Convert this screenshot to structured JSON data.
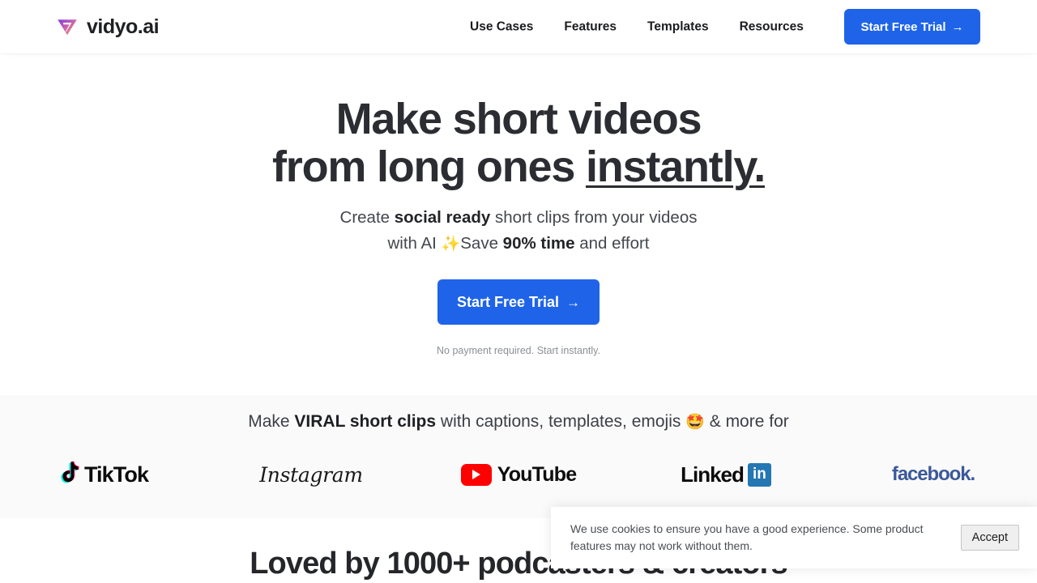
{
  "header": {
    "brand": {
      "name": "vidyo.ai",
      "logo_icon": "vidyo-triangle-play-logo"
    },
    "nav": [
      {
        "label": "Use Cases"
      },
      {
        "label": "Features"
      },
      {
        "label": "Templates"
      },
      {
        "label": "Resources"
      }
    ],
    "cta": {
      "label": "Start Free Trial",
      "arrow": "→",
      "bg_color": "#1f64e8",
      "text_color": "#ffffff"
    }
  },
  "hero": {
    "title_line1": "Make short videos",
    "title_line2_plain": "from long ones ",
    "title_line2_underlined": "instantly.",
    "subtitle": {
      "l1_a": "Create ",
      "l1_b": "social ready",
      "l1_c": " short clips from your videos",
      "l2_a": "with AI ",
      "l2_emoji": "✨",
      "l2_b": "Save ",
      "l2_c": "90% time",
      "l2_d": " and effort"
    },
    "cta": {
      "label": "Start Free Trial",
      "arrow": "→"
    },
    "note": "No payment required. Start instantly."
  },
  "social_band": {
    "headline_a": "Make ",
    "headline_b": "VIRAL short clips",
    "headline_c": " with captions, templates, emojis ",
    "headline_emoji": "🤩",
    "headline_d": " & more for",
    "bg_color": "#fafafa",
    "logos": [
      {
        "name": "TikTok",
        "icon": "tiktok-note-icon",
        "wordmark": "TikTok",
        "color": "#0b0b0b"
      },
      {
        "name": "Instagram",
        "icon": "instagram-wordmark",
        "wordmark": "Instagram",
        "color": "#1a1a1a"
      },
      {
        "name": "YouTube",
        "icon": "youtube-play-badge",
        "wordmark": "YouTube",
        "color": "#ff0000"
      },
      {
        "name": "LinkedIn",
        "icon": "linkedin-badge",
        "wordmark": "Linked",
        "badge_text": "in",
        "color": "#2477b3"
      },
      {
        "name": "facebook",
        "icon": "facebook-wordmark",
        "wordmark": "facebook.",
        "color": "#3b5998"
      }
    ]
  },
  "loved_section": {
    "title": "Loved by 1000+ podcasters & creators"
  },
  "cookie_banner": {
    "message": "We use cookies to ensure you have a good experience. Some product features may not work without them.",
    "accept_label": "Accept"
  }
}
